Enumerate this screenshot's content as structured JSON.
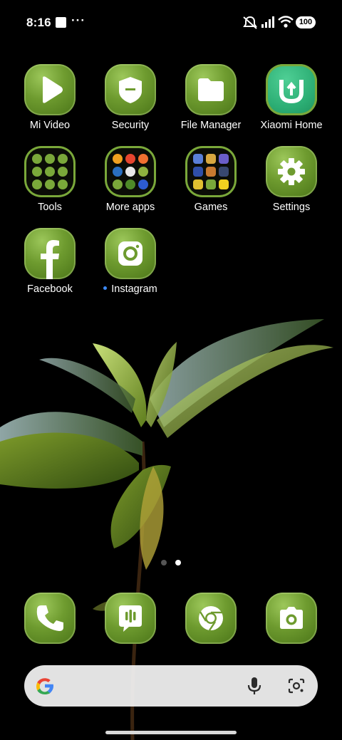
{
  "status_bar": {
    "time": "8:16",
    "more": "···",
    "battery": "100",
    "icons": [
      "silent-icon",
      "signal-icon",
      "wifi-icon",
      "battery-icon"
    ]
  },
  "apps": [
    {
      "label": "Mi Video",
      "icon": "play-icon"
    },
    {
      "label": "Security",
      "icon": "shield-icon"
    },
    {
      "label": "File Manager",
      "icon": "folder-icon"
    },
    {
      "label": "Xiaomi Home",
      "icon": "mi-home-icon"
    },
    {
      "label": "Tools",
      "icon": "folder-tools"
    },
    {
      "label": "More apps",
      "icon": "folder-more-apps"
    },
    {
      "label": "Games",
      "icon": "folder-games"
    },
    {
      "label": "Settings",
      "icon": "gear-icon"
    },
    {
      "label": "Facebook",
      "icon": "facebook-icon"
    },
    {
      "label": "Instagram",
      "icon": "instagram-icon",
      "new_indicator": true
    }
  ],
  "pager": {
    "pages": 2,
    "current": 2
  },
  "dock": [
    "phone-icon",
    "messages-icon",
    "chrome-icon",
    "camera-icon"
  ],
  "search_bar": {
    "icons": [
      "google-icon",
      "mic-icon",
      "lens-icon"
    ]
  },
  "colors": {
    "icon_green": "#6e9b2f",
    "mi_home_teal": "#2cae74",
    "new_dot": "#3d8af7"
  }
}
